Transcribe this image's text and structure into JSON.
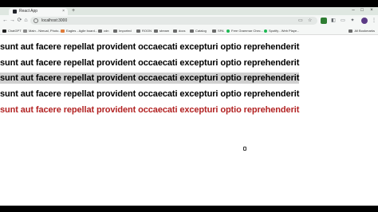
{
  "browser": {
    "tab": {
      "title": "React App",
      "close": "×"
    },
    "new_tab": "+",
    "window_controls": {
      "minimize": "–",
      "maximize": "□",
      "close": "×"
    },
    "address": "localhost:3000",
    "nav": {
      "back": "←",
      "forward": "→",
      "reload": "⟳",
      "home": "⌂"
    },
    "bookmarks": [
      "ChatGPT",
      "Main - Nimual, Photo...",
      "Eagles - Agile board...",
      "cdn",
      "Imported",
      "ROON",
      "stream",
      "docs",
      "Catalog",
      "SPA",
      "Free Grammar Chec...",
      "Spotify - Web Playe..."
    ],
    "all_bookmarks": "All Bookmarks"
  },
  "content": {
    "lines": [
      {
        "text": "sunt aut facere repellat provident occaecati excepturi optio reprehenderit",
        "color": "#000000",
        "selected": false
      },
      {
        "text": "sunt aut facere repellat provident occaecati excepturi optio reprehenderit",
        "color": "#000000",
        "selected": false
      },
      {
        "text": "sunt aut facere repellat provident occaecati excepturi optio reprehenderit",
        "color": "#000000",
        "selected": true
      },
      {
        "text": "sunt aut facere repellat provident occaecati excepturi optio reprehenderit",
        "color": "#000000",
        "selected": false
      },
      {
        "text": "sunt aut facere repellat provident occaecati excepturi optio reprehenderit",
        "color": "#b22222",
        "selected": false
      }
    ]
  }
}
